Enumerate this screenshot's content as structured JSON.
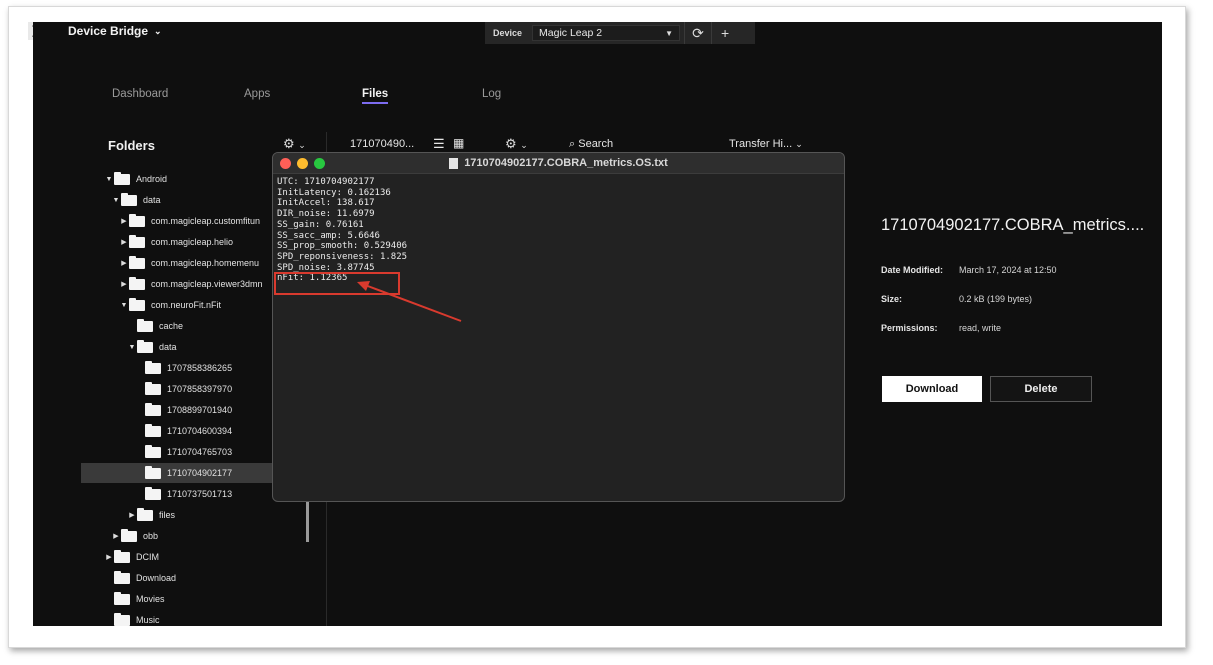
{
  "header": {
    "app_name": "Device Bridge",
    "device_label": "Device",
    "device_selected": "Magic Leap 2"
  },
  "tabs": [
    "Dashboard",
    "Apps",
    "Files",
    "Log"
  ],
  "active_tab": "Files",
  "folders": {
    "title": "Folders",
    "tree": [
      "Android",
      "data",
      "com.magicleap.customfitun",
      "com.magicleap.helio",
      "com.magicleap.homemenu",
      "com.magicleap.viewer3dmn",
      "com.neuroFit.nFit",
      "cache",
      "data",
      "1707858386265",
      "1707858397970",
      "1708899701940",
      "1710704600394",
      "1710704765703",
      "1710704902177",
      "1710737501713",
      "files",
      "obb",
      "DCIM",
      "Download",
      "Movies",
      "Music"
    ]
  },
  "file_toolbar": {
    "path": "171070490...",
    "search": "Search",
    "transfer": "Transfer Hi..."
  },
  "details": {
    "title": "1710704902177.COBRA_metrics....",
    "date_label": "Date Modified:",
    "date_value": "March 17, 2024 at 12:50",
    "size_label": "Size:",
    "size_value": "0.2 kB (199 bytes)",
    "perm_label": "Permissions:",
    "perm_value": "read, write",
    "download": "Download",
    "delete": "Delete"
  },
  "text_window": {
    "title": "1710704902177.COBRA_metrics.OS.txt",
    "lines": [
      "UTC: 1710704902177",
      "InitLatency: 0.162136",
      "InitAccel: 138.617",
      "DIR_noise: 11.6979",
      "SS_gain: 0.76161",
      "SS_sacc_amp: 5.6646",
      "SS_prop_smooth: 0.529406",
      "SPD_reponsiveness: 1.825",
      "SPD_noise: 3.87745",
      "nFit: 1.12365"
    ]
  },
  "colors": {
    "accent": "#7d6cf0",
    "highlight": "#d93a2e"
  }
}
